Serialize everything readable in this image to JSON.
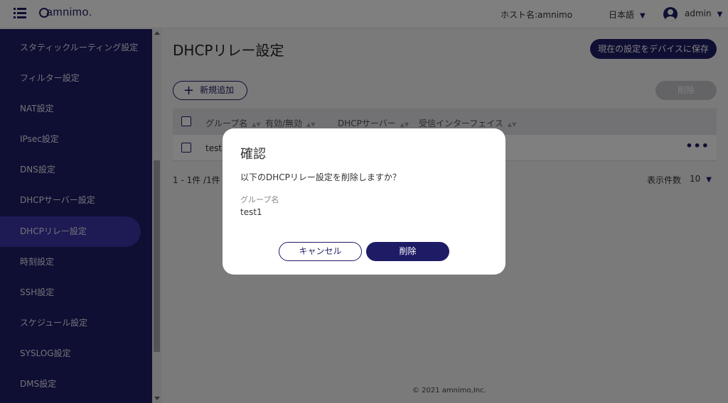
{
  "header": {
    "logo_text": "amnimo.",
    "host_label": "ホスト名:amnimo",
    "language": "日本語",
    "user": "admin"
  },
  "sidebar": {
    "items": [
      {
        "label": "スタティックルーティング設定",
        "active": false
      },
      {
        "label": "フィルター設定",
        "active": false
      },
      {
        "label": "NAT設定",
        "active": false
      },
      {
        "label": "IPsec設定",
        "active": false
      },
      {
        "label": "DNS設定",
        "active": false
      },
      {
        "label": "DHCPサーバー設定",
        "active": false
      },
      {
        "label": "DHCPリレー設定",
        "active": true
      },
      {
        "label": "時刻設定",
        "active": false
      },
      {
        "label": "SSH設定",
        "active": false
      },
      {
        "label": "スケジュール設定",
        "active": false
      },
      {
        "label": "SYSLOG設定",
        "active": false
      },
      {
        "label": "DMS設定",
        "active": false
      }
    ]
  },
  "main": {
    "title": "DHCPリレー設定",
    "save_button": "現在の設定をデバイスに保存",
    "new_button": "新規追加",
    "delete_button": "削除",
    "table": {
      "columns": [
        "グループ名",
        "有効/無効",
        "DHCPサーバー",
        "受信インターフェイス"
      ],
      "rows": [
        {
          "group": "test1"
        }
      ]
    },
    "pagination": "1 - 1件 /1件",
    "per_page_label": "表示件数",
    "per_page_value": "10"
  },
  "footer": "© 2021 amnimo,Inc.",
  "dialog": {
    "title": "確認",
    "message": "以下のDHCPリレー設定を削除しますか？",
    "field_label": "グループ名",
    "field_value": "test1",
    "cancel_button": "キャンセル",
    "confirm_button": "削除"
  },
  "colors": {
    "brand": "#1f1c66",
    "active_nav": "#3b34a8",
    "disabled": "#c8c8cc"
  }
}
